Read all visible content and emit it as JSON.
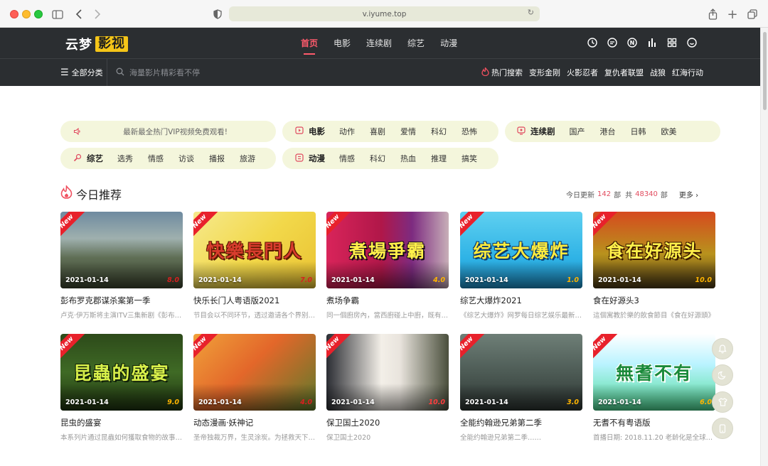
{
  "browser": {
    "url": "v.iyume.top"
  },
  "site": {
    "logo_text": "云梦",
    "logo_box": "影视",
    "nav": [
      "首页",
      "电影",
      "连续剧",
      "综艺",
      "动漫"
    ],
    "all_categories": "全部分类",
    "search_placeholder": "海量影片精彩看不停",
    "hot_label": "热门搜索",
    "hot_terms": [
      "变形金刚",
      "火影忍者",
      "复仇者联盟",
      "战狼",
      "红海行动"
    ]
  },
  "notice": "最新最全热门VIP视频免费观看!",
  "categories": {
    "movie": {
      "title": "电影",
      "items": [
        "动作",
        "喜剧",
        "爱情",
        "科幻",
        "恐怖"
      ]
    },
    "series": {
      "title": "连续剧",
      "items": [
        "国产",
        "港台",
        "日韩",
        "欧美"
      ]
    },
    "variety": {
      "title": "综艺",
      "items": [
        "选秀",
        "情感",
        "访谈",
        "播报",
        "旅游"
      ]
    },
    "anime": {
      "title": "动漫",
      "items": [
        "情感",
        "科幻",
        "热血",
        "推理",
        "搞笑"
      ]
    }
  },
  "recommend": {
    "title": "今日推荐",
    "update_prefix": "今日更新",
    "update_count": "142",
    "unit1": "部",
    "total_prefix": "共",
    "total_count": "48340",
    "unit2": "部",
    "more": "更多"
  },
  "new_badge": "New",
  "cards": [
    {
      "date": "2021-01-14",
      "score": "8.0",
      "title": "彭布罗克郡谋杀案第一季",
      "desc": "卢克·伊万斯将主演ITV三集新剧《彭布罗克郡谋杀案》"
    },
    {
      "date": "2021-01-14",
      "score": "7.0",
      "title": "快乐长门人粤语版2021",
      "desc": "节目会以不同环节，透过邀请各个界别嘉宾"
    },
    {
      "date": "2021-01-14",
      "score": "4.0",
      "title": "煮场争霸",
      "desc": "同一個廚房內，當西廚碰上中廚，既有碰撞"
    },
    {
      "date": "2021-01-14",
      "score": "1.0",
      "title": "综艺大爆炸2021",
      "desc": "《综艺大爆炸》网罗每日综艺娱乐最新资讯"
    },
    {
      "date": "2021-01-14",
      "score": "10.0",
      "title": "食在好源头3",
      "desc": "這個寓教於樂的飲食節目《食在好源頭》"
    },
    {
      "date": "2021-01-14",
      "score": "9.0",
      "title": "昆虫的盛宴",
      "desc": "本系列片通过昆蟲如何獲取食物的故事展开"
    },
    {
      "date": "2021-01-14",
      "score": "4.0",
      "title": "动态漫画·妖神记",
      "desc": "圣帝独裁万界，生灵涂炭。为拯救天下苍生"
    },
    {
      "date": "2021-01-14",
      "score": "10.0",
      "title": "保卫国土2020",
      "desc": "保卫国土2020"
    },
    {
      "date": "2021-01-14",
      "score": "3.0",
      "title": "全能约翰逊兄弟第二季",
      "desc": "全能约翰逊兄弟第二季……"
    },
    {
      "date": "2021-01-14",
      "score": "6.0",
      "title": "无耆不有粤语版",
      "desc": "首播日期: 2018.11.20 老龄化是全球都面临的"
    }
  ],
  "art": [
    "",
    "快樂長門人",
    "煮場爭霸",
    "综艺大爆炸",
    "食在好源头",
    "昆蟲的盛宴",
    "",
    "",
    "",
    "無耆不有"
  ],
  "colors": {
    "accent": "#ff5a6c",
    "header": "#2b2e31",
    "pill": "#f4f6dc",
    "score": "#ffb400"
  }
}
